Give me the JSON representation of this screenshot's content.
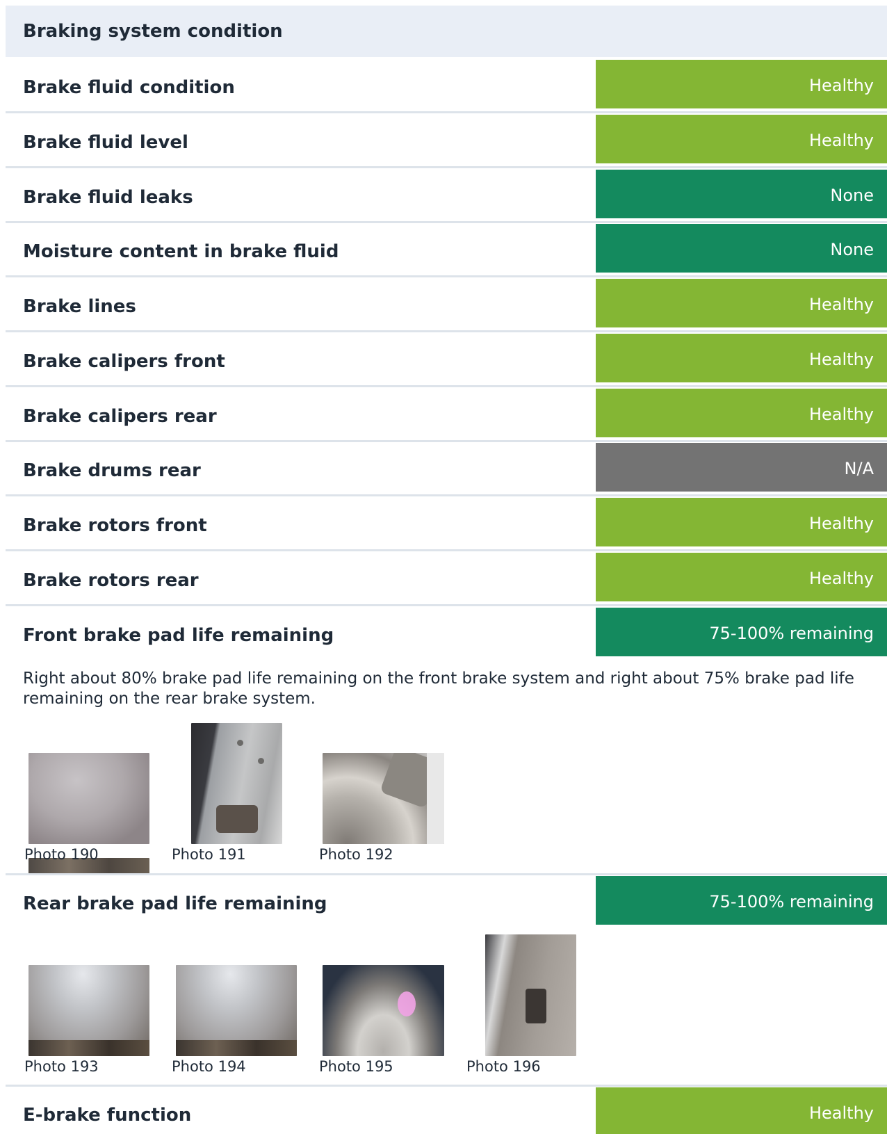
{
  "section": {
    "title": "Braking system condition"
  },
  "colors": {
    "healthy": "#84b634",
    "none": "#148a5e",
    "na": "#737373",
    "remaining": "#148a5e"
  },
  "rows": [
    {
      "label": "Brake fluid condition",
      "status": "Healthy",
      "status_color": "#84b634"
    },
    {
      "label": "Brake fluid level",
      "status": "Healthy",
      "status_color": "#84b634"
    },
    {
      "label": "Brake fluid leaks",
      "status": "None",
      "status_color": "#148a5e"
    },
    {
      "label": "Moisture content in brake fluid",
      "status": "None",
      "status_color": "#148a5e"
    },
    {
      "label": "Brake lines",
      "status": "Healthy",
      "status_color": "#84b634"
    },
    {
      "label": "Brake calipers front",
      "status": "Healthy",
      "status_color": "#84b634"
    },
    {
      "label": "Brake calipers rear",
      "status": "Healthy",
      "status_color": "#84b634"
    },
    {
      "label": "Brake drums rear",
      "status": "N/A",
      "status_color": "#737373"
    },
    {
      "label": "Brake rotors front",
      "status": "Healthy",
      "status_color": "#84b634"
    },
    {
      "label": "Brake rotors rear",
      "status": "Healthy",
      "status_color": "#84b634"
    },
    {
      "label": "Front brake pad life remaining",
      "status": "75-100% remaining",
      "status_color": "#148a5e"
    }
  ],
  "front_pad_note": "Right about 80% brake pad life remaining on the front brake system and right about 75% brake pad life remaining on the rear brake system.",
  "front_photos": [
    {
      "caption": "Photo 190"
    },
    {
      "caption": "Photo 191"
    },
    {
      "caption": "Photo 192"
    }
  ],
  "rear_pad": {
    "label": "Rear brake pad life remaining",
    "status": "75-100% remaining",
    "status_color": "#148a5e"
  },
  "rear_photos": [
    {
      "caption": "Photo 193"
    },
    {
      "caption": "Photo 194"
    },
    {
      "caption": "Photo 195"
    },
    {
      "caption": "Photo 196"
    }
  ],
  "ebrake": {
    "label": "E-brake function",
    "status": "Healthy",
    "status_color": "#84b634"
  }
}
